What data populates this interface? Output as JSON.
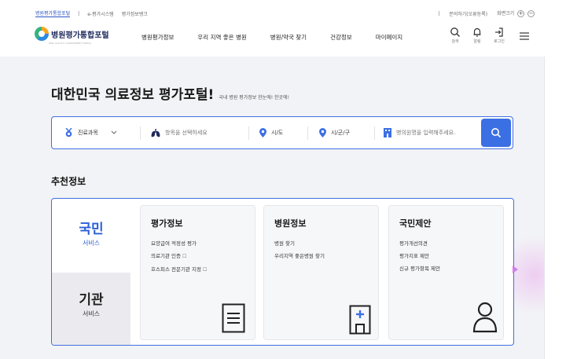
{
  "topbar": {
    "sites": [
      "병원평가통합포털",
      "e-평가시스템",
      "평가정보뱅크"
    ],
    "inquiry": "문의하기(오류등록)",
    "zoom_label": "화면크기",
    "zoom_in": "+",
    "zoom_out": "−"
  },
  "header": {
    "logo_text": "병원평가통합포털",
    "logo_sub": "HIRA QUALITY ASSESSMENT PORTAL",
    "nav": [
      "병원평가정보",
      "우리 지역 좋은 병원",
      "병원/약국 찾기",
      "건강정보",
      "마이페이지"
    ],
    "icons": [
      {
        "name": "search-icon",
        "label": "검색"
      },
      {
        "name": "bell-icon",
        "label": "알림"
      },
      {
        "name": "login-icon",
        "label": "로그인"
      }
    ]
  },
  "hero": {
    "title": "대한민국 의료정보 평가포털!",
    "subtitle": "국내 병원 평가정보 한눈에! 한곳에!"
  },
  "search": {
    "department": "진료과목",
    "item_placeholder": "항목을 선택하세요",
    "sido": "시/도",
    "sigungu": "시/군/구",
    "hospital_placeholder": "병의원명을 입력해주세요."
  },
  "recommend": {
    "title": "추천정보",
    "tabs": [
      {
        "main": "국민",
        "sub": "서비스"
      },
      {
        "main": "기관",
        "sub": "서비스"
      }
    ],
    "cards": [
      {
        "title": "평가정보",
        "links": [
          "요양급여 적정성 평가",
          "의료기관 인증",
          "호스피스 전문기관 지정"
        ]
      },
      {
        "title": "병원정보",
        "links": [
          "병원 찾기",
          "우리지역 좋은병원 찾기"
        ]
      },
      {
        "title": "국민제안",
        "links": [
          "평가개선의견",
          "평가지표 제안",
          "신규 평가항목 제안"
        ]
      }
    ],
    "ext_mark": "☐"
  },
  "colors": {
    "accent": "#3b6fe4",
    "hero_bg": "#f2f3f6",
    "navy": "#1d2a5c"
  }
}
